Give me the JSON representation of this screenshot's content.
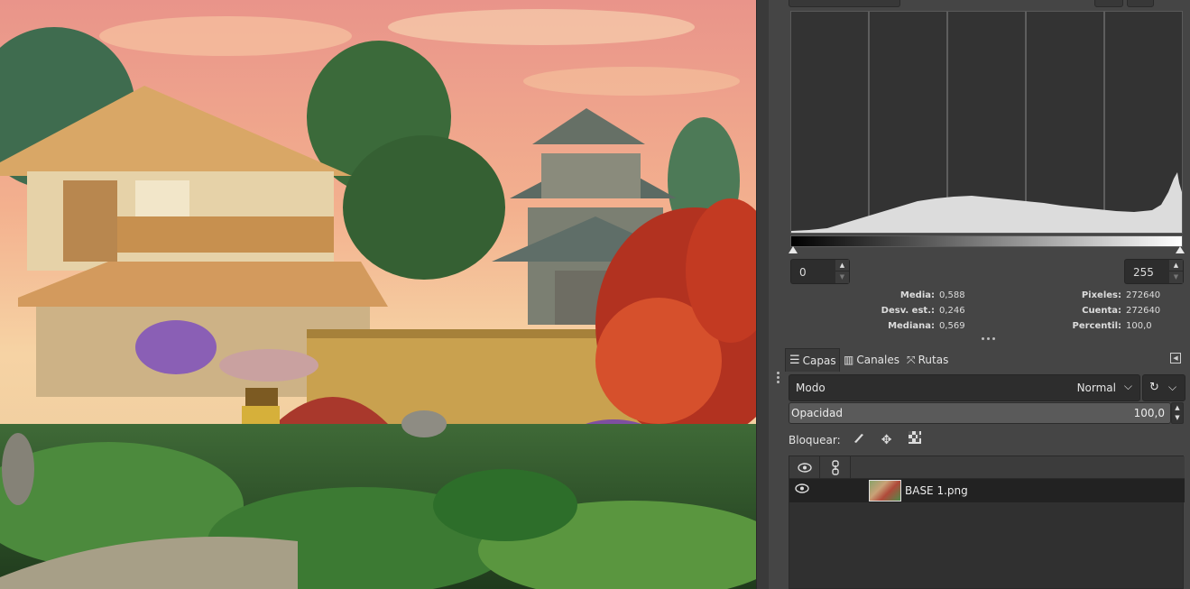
{
  "canvas": {
    "image_name": "BASE 1.png"
  },
  "histogram": {
    "range_low": "0",
    "range_high": "255",
    "stats_left": [
      {
        "label": "Media:",
        "value": "0,588"
      },
      {
        "label": "Desv. est.:",
        "value": "0,246"
      },
      {
        "label": "Mediana:",
        "value": "0,569"
      }
    ],
    "stats_right": [
      {
        "label": "Pixeles:",
        "value": "272640"
      },
      {
        "label": "Cuenta:",
        "value": "272640"
      },
      {
        "label": "Percentil:",
        "value": "100,0"
      }
    ]
  },
  "layers_panel": {
    "tabs": [
      {
        "label": "Capas",
        "icon": "layers-icon"
      },
      {
        "label": "Canales",
        "icon": "channels-icon"
      },
      {
        "label": "Rutas",
        "icon": "paths-icon"
      }
    ],
    "mode_label": "Modo",
    "mode_value": "Normal",
    "opacity_label": "Opacidad",
    "opacity_value": "100,0",
    "lock_label": "Bloquear:",
    "layers": [
      {
        "name": "BASE 1.png",
        "visible": true
      }
    ]
  },
  "colors": {
    "panel_bg": "#454545",
    "field_bg": "#2d2d2d",
    "histogram_fill": "#dcdcdc",
    "selected_row": "#222222"
  }
}
